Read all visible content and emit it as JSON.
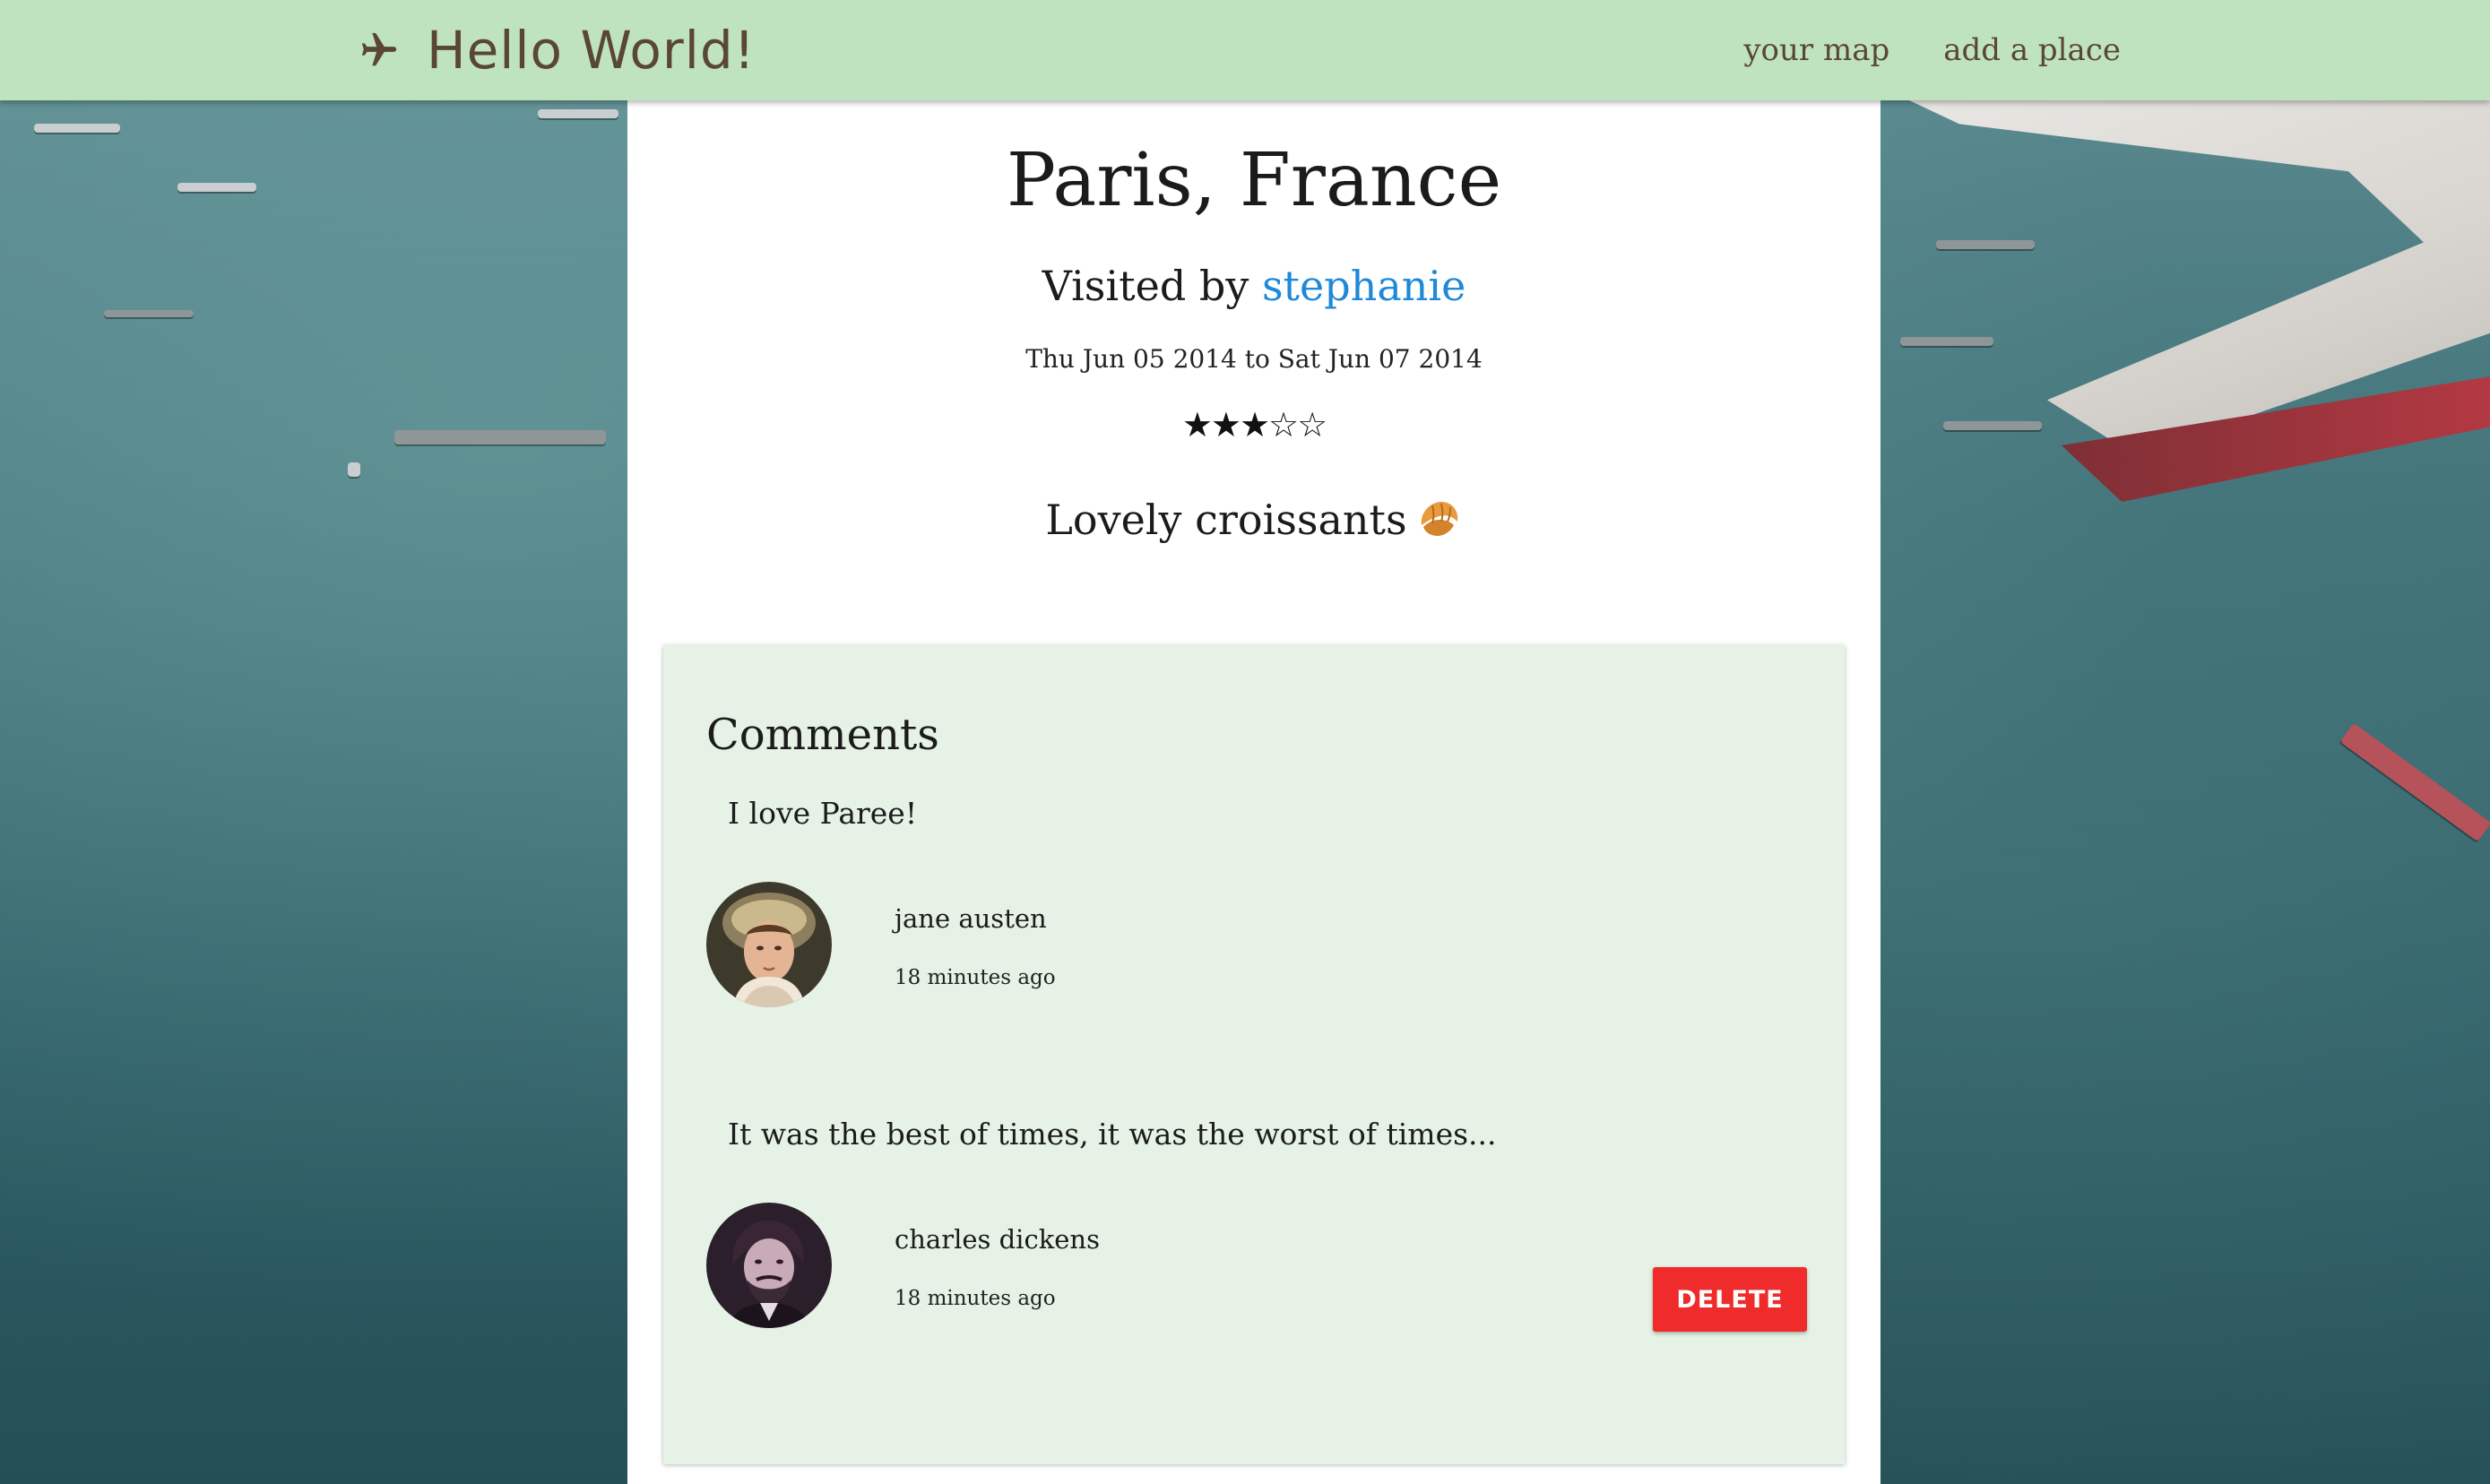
{
  "header": {
    "brand_title": "Hello World!",
    "brand_icon": "airplane-icon",
    "nav": [
      {
        "label": "your map"
      },
      {
        "label": "add a place"
      }
    ]
  },
  "place": {
    "title": "Paris, France",
    "visited_prefix": "Visited by ",
    "visited_by": "stephanie",
    "dates": "Thu Jun 05 2014 to Sat Jun 07 2014",
    "rating": 3,
    "rating_max": 5,
    "stars_text": "★★★☆☆",
    "note": "Lovely croissants",
    "note_icon": "croissant-icon"
  },
  "comments": {
    "title": "Comments",
    "items": [
      {
        "text": "I love Paree!",
        "author": "jane austen",
        "time": "18 minutes ago",
        "avatar": "avatar-jane-austen"
      },
      {
        "text": "It was the best of times, it was the worst of times...",
        "author": "charles dickens",
        "time": "18 minutes ago",
        "avatar": "avatar-charles-dickens",
        "delete_label": "DELETE"
      }
    ]
  },
  "colors": {
    "navbar": "#bfe3bf",
    "brand_text": "#5a4733",
    "link": "#1e88d9",
    "comments_bg": "#e5f2e5",
    "delete_button": "#ef2b2b"
  }
}
